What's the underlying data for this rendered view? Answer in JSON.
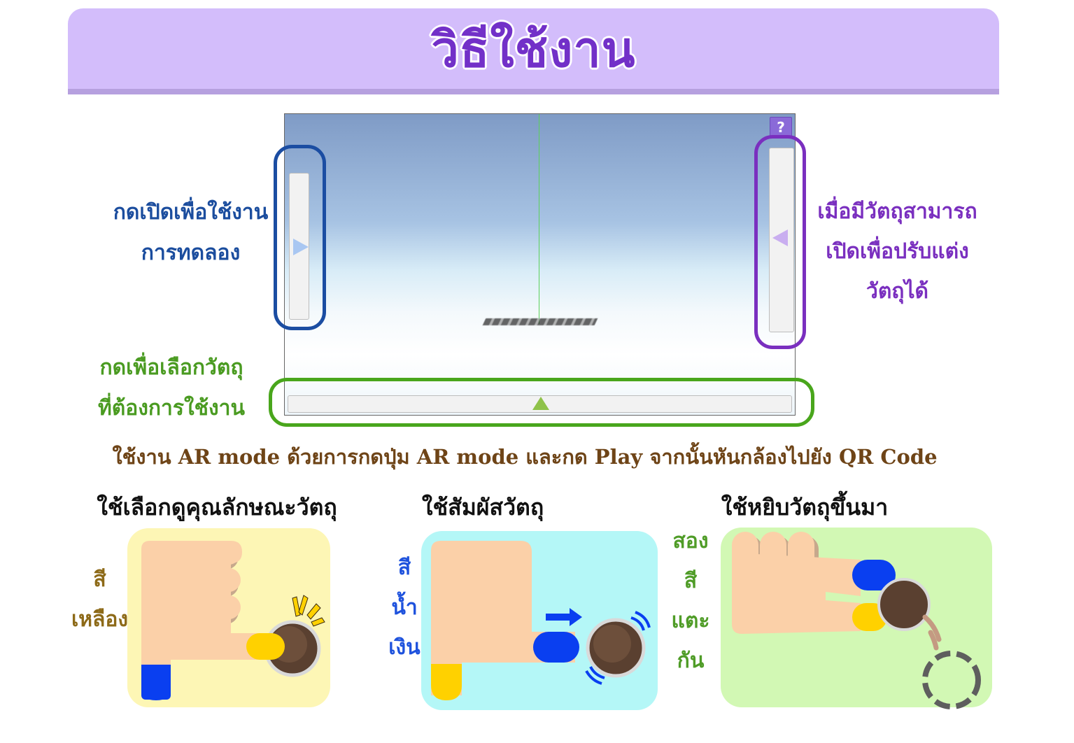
{
  "header": {
    "title": "วิธีใช้งาน"
  },
  "preview": {
    "help_label": "?"
  },
  "callouts": {
    "left_panel": [
      "กดเปิดเพื่อใช้งาน",
      "การทดลอง"
    ],
    "right_panel": [
      "เมื่อมีวัตถุสามารถ",
      "เปิดเพื่อปรับแต่ง",
      "วัตถุได้"
    ],
    "bottom_panel": [
      "กดเพื่อเลือกวัตถุ",
      "ที่ต้องการใช้งาน"
    ]
  },
  "instruction": "ใช้งาน AR mode ด้วยการกดปุ่ม AR mode และกด Play จากนั้นหันกล้องไปยัง QR Code",
  "modes": [
    {
      "title": "ใช้เลือกดูคุณลักษณะวัตถุ",
      "color_label": [
        "สี",
        "เหลือง"
      ]
    },
    {
      "title": "ใช้สัมผัสวัตถุ",
      "color_label": [
        "สี",
        "น้ำ",
        "เงิน"
      ]
    },
    {
      "title": "ใช้หยิบวัตถุขึ้นมา",
      "color_label": [
        "สอง",
        "สี",
        "แตะ",
        "กัน"
      ]
    }
  ],
  "colors": {
    "title": "#7230c8",
    "header_bg": "#d3bdfb",
    "blue_ring": "#1b4da2",
    "purple_ring": "#7a2fbf",
    "green_ring": "#49a61c",
    "instruction": "#6e4417",
    "skin": "#fbd0a8",
    "finger_yellow": "#ffd100",
    "finger_blue": "#0a3ff0"
  }
}
